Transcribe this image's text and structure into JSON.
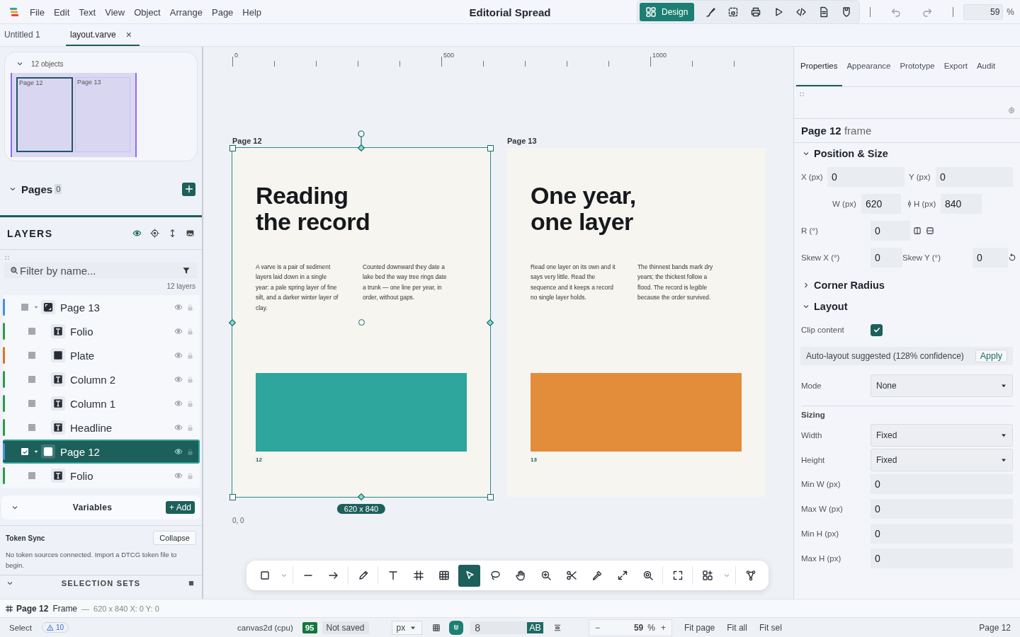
{
  "menubar": {
    "menus": [
      "File",
      "Edit",
      "Text",
      "View",
      "Object",
      "Arrange",
      "Page",
      "Help"
    ],
    "title": "Editorial Spread",
    "modes": [
      {
        "kind": "design",
        "label": "Design",
        "selected": true
      },
      {
        "kind": "brush",
        "selected": false
      },
      {
        "kind": "frame",
        "selected": false
      },
      {
        "kind": "print",
        "selected": false
      },
      {
        "kind": "play",
        "selected": false
      },
      {
        "kind": "code",
        "selected": false
      },
      {
        "kind": "doc",
        "selected": false
      },
      {
        "kind": "shield",
        "selected": false
      }
    ],
    "zoom": "59",
    "zoom_unit": "%"
  },
  "doc_tabs": [
    {
      "label": "Untitled 1",
      "selected": false
    },
    {
      "label": "layout.varve",
      "selected": true,
      "close": "×"
    }
  ],
  "minimap": {
    "count": "12 objects",
    "expanded": true,
    "pages": [
      {
        "label": "Page 12",
        "selected": true
      },
      {
        "label": "Page 13",
        "selected": false
      }
    ]
  },
  "pages_section": {
    "title": "Pages",
    "count": "0",
    "expanded": true
  },
  "layers": {
    "title": "LAYERS",
    "filter_placeholder": "Filter by name...",
    "count": "12 layers",
    "items": [
      {
        "kind": "frame",
        "name": "Page 13",
        "color": "#4a90d9",
        "checked": false,
        "selected": false,
        "expanded": true,
        "children": [
          {
            "kind": "text",
            "name": "Folio",
            "color": "#2e9a48",
            "checked": false,
            "selected": false
          },
          {
            "kind": "rect",
            "name": "Plate",
            "color": "#d2782e",
            "checked": false,
            "selected": false
          },
          {
            "kind": "text",
            "name": "Column 2",
            "color": "#2e9a48",
            "checked": false,
            "selected": false
          },
          {
            "kind": "text",
            "name": "Column 1",
            "color": "#2e9a48",
            "checked": false,
            "selected": false
          },
          {
            "kind": "text",
            "name": "Headline",
            "color": "#2e9a48",
            "checked": false,
            "selected": false
          }
        ]
      },
      {
        "kind": "frame",
        "name": "Page 12",
        "color": "#4a90d9",
        "checked": true,
        "selected": true,
        "expanded": true,
        "children": [
          {
            "kind": "text",
            "name": "Folio",
            "color": "#2e9a48",
            "checked": false,
            "selected": false
          }
        ]
      }
    ]
  },
  "variables": {
    "title": "Variables",
    "expanded": true,
    "add": "+ Add"
  },
  "token_sync": {
    "title": "Token Sync",
    "button": "Collapse",
    "message": "No token sources connected. Import a DTCG token file to begin."
  },
  "selection_sets": {
    "title": "SELECTION SETS",
    "expanded": true
  },
  "canvas": {
    "ruler": [
      "0",
      "500",
      "1000"
    ],
    "origin": "0, 0",
    "size_badge": "620 x 840",
    "frames": [
      {
        "label": "Page 12",
        "selected": true,
        "headline": "Reading\nthe record",
        "columns": [
          "A varve is a pair of sediment layers laid down in a single year: a pale spring layer of fine silt, and a darker winter layer of clay.",
          "Counted downward they date a lake bed the way tree rings date a trunk — one line per year, in order, without gaps."
        ],
        "color": "#2ea59d",
        "folio": "12"
      },
      {
        "label": "Page 13",
        "selected": false,
        "headline": "One year,\none layer",
        "columns": [
          "Read one layer on its own and it says very little. Read the sequence and it keeps a record no single layer holds.",
          "The thinnest bands mark dry years; the thickest follow a flood. The record is legible because the order survived."
        ],
        "color": "#e38d3b",
        "folio": "13"
      }
    ]
  },
  "toolbar": [
    [
      {
        "kind": "rect",
        "selected": false
      },
      {
        "kind": "caret",
        "selected": false
      }
    ],
    [
      {
        "kind": "line",
        "selected": false
      },
      {
        "kind": "arrow",
        "selected": false
      }
    ],
    [
      {
        "kind": "pencil",
        "selected": false
      }
    ],
    [
      {
        "kind": "text",
        "selected": false
      },
      {
        "kind": "frame",
        "selected": false
      },
      {
        "kind": "table",
        "selected": false
      },
      {
        "kind": "select",
        "selected": true
      },
      {
        "kind": "lasso",
        "selected": false
      },
      {
        "kind": "hand",
        "selected": false
      },
      {
        "kind": "zoom",
        "selected": false
      },
      {
        "kind": "scissors",
        "selected": false
      },
      {
        "kind": "eyedropper",
        "selected": false
      },
      {
        "kind": "expand",
        "selected": false
      },
      {
        "kind": "zoomfit",
        "selected": false
      }
    ],
    [
      {
        "kind": "fullscreen",
        "selected": false
      }
    ],
    [
      {
        "kind": "components",
        "selected": false
      },
      {
        "kind": "caret",
        "selected": false
      }
    ],
    [
      {
        "kind": "vector",
        "selected": false
      }
    ]
  ],
  "inspector": {
    "tabs": [
      {
        "label": "Properties",
        "selected": true
      },
      {
        "label": "Appearance",
        "selected": false
      },
      {
        "label": "Prototype",
        "selected": false
      },
      {
        "label": "Export",
        "selected": false
      },
      {
        "label": "Audit",
        "selected": false
      }
    ],
    "heading": "**Page 12** frame",
    "position": {
      "title": "Position & Size",
      "expanded": true,
      "x": {
        "label": "X (px)",
        "value": "0"
      },
      "y": {
        "label": "Y (px)",
        "value": "0"
      },
      "w": {
        "label": "W (px)",
        "value": "620"
      },
      "h": {
        "label": "H (px)",
        "value": "840"
      },
      "r": {
        "label": "R (°)",
        "value": "0"
      },
      "skew_x": {
        "label": "Skew X (°)",
        "value": "0"
      },
      "skew_y": {
        "label": "Skew Y (°)",
        "value": "0"
      }
    },
    "corner_radius": {
      "title": "Corner Radius",
      "expanded": false
    },
    "layout": {
      "title": "Layout",
      "expanded": true,
      "clip": {
        "label": "Clip content",
        "checked": true
      },
      "suggestion": {
        "text": "Auto-layout suggested (128% confidence)",
        "action": "Apply"
      },
      "mode": {
        "label": "Mode",
        "value": "None"
      },
      "sizing_title": "Sizing",
      "sizing": [
        {
          "kind": "select",
          "label": "Width",
          "value": "Fixed"
        },
        {
          "kind": "select",
          "label": "Height",
          "value": "Fixed"
        },
        {
          "kind": "input",
          "label": "Min W (px)",
          "value": "0"
        },
        {
          "kind": "input",
          "label": "Max W (px)",
          "value": "0"
        },
        {
          "kind": "input",
          "label": "Min H (px)",
          "value": "0"
        },
        {
          "kind": "input",
          "label": "Max H (px)",
          "value": "0"
        }
      ]
    }
  },
  "status_line": {
    "name": "Page 12",
    "type": "Frame",
    "separator": "—",
    "details": "620 x 840 X: 0 Y: 0"
  },
  "bottom_bar": {
    "tool": "Select",
    "warnings": "10",
    "renderer": "canvas2d (cpu)",
    "score": "95",
    "save_state": "Not saved",
    "unit": "px",
    "grid_size": "8",
    "text_badge": "AB",
    "zoom": "59",
    "zoom_unit": "%",
    "zoom_out": "−",
    "zoom_in": "+",
    "fit": [
      "Fit page",
      "Fit all",
      "Fit sel"
    ],
    "page": "Page 12"
  }
}
